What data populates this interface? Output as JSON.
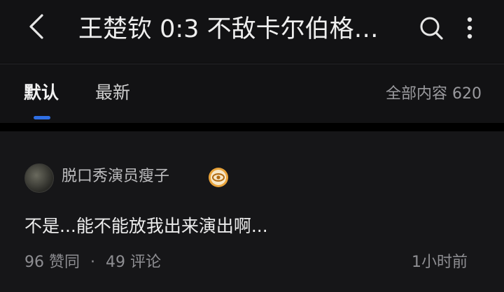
{
  "header": {
    "title": "王楚钦 0:3 不敌卡尔伯格…",
    "back_icon": "chevron-left-icon",
    "search_icon": "search-icon",
    "more_icon": "more-vertical-icon"
  },
  "tabs": [
    {
      "label": "默认",
      "active": true
    },
    {
      "label": "最新",
      "active": false
    }
  ],
  "total_count": "全部内容 620",
  "comment": {
    "username": "脱口秀演员瘦子",
    "badge_icon": "eye-badge-icon",
    "text": "不是...能不能放我出来演出啊...",
    "likes_label": "96 赞同",
    "separator": "·",
    "comments_label": "49 评论",
    "time": "1小时前"
  },
  "colors": {
    "background": "#0b0b0c",
    "surface": "#121214",
    "accent": "#2f6fe4",
    "badge": "#e8a33a"
  }
}
